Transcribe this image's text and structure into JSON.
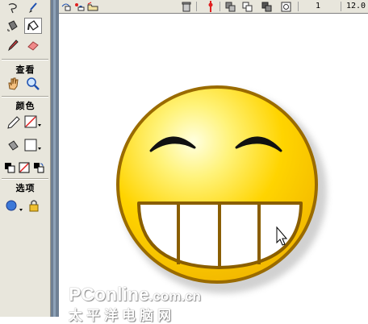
{
  "tools_panel": {
    "view_title": "查看",
    "colors_title": "颜色",
    "options_title": "选项"
  },
  "toolbar": {
    "frame_value": "1",
    "fps_value": "12.0"
  },
  "colors": {
    "face_fill": "#ffd400",
    "face_outline": "#9a6b00",
    "stroke_color": "#e02020",
    "panel_bg": "#e8e6dc",
    "gutter": "#6f8094"
  },
  "icons": [
    "ink-bottle-icon",
    "paint-bucket-icon",
    "eyedropper-icon",
    "eraser-icon",
    "hand-icon",
    "magnifier-icon",
    "pencil-icon",
    "paint-bucket-icon",
    "swap-colors-icon",
    "snap-magnet-icon",
    "trash-icon",
    "onion-skin-icon"
  ],
  "watermark": {
    "line1": "PConline",
    "line1_suffix": ".com.cn",
    "line2": "太平洋电脑网"
  }
}
